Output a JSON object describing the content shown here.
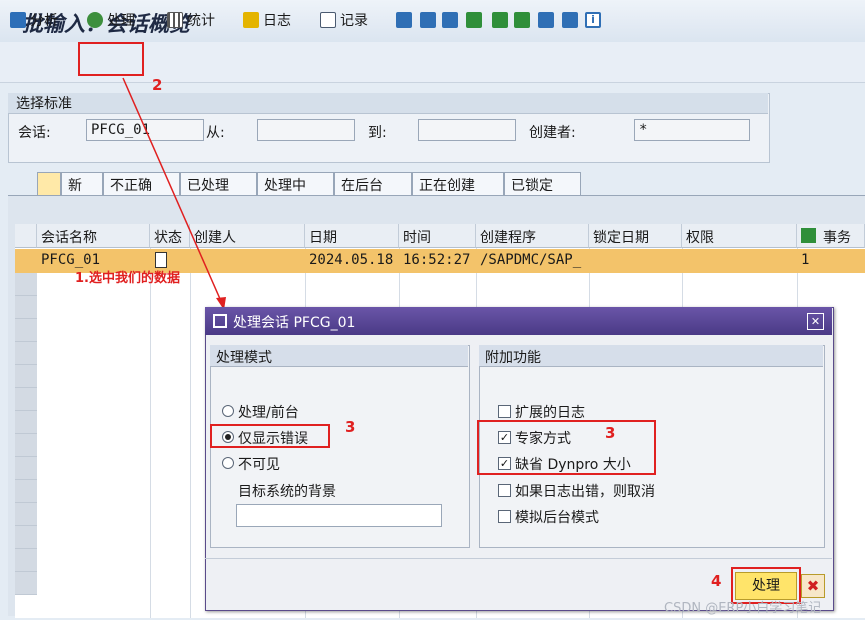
{
  "window": {
    "title": "批输入：会话概览"
  },
  "toolbar": {
    "analyze_label": "分析",
    "process_label": "处理",
    "stats_label": "统计",
    "log_label": "日志",
    "record_label": "记录",
    "info_icon_glyph": "i"
  },
  "selection": {
    "header": "选择标准",
    "session_label": "会话:",
    "session_value": "PFCG_01",
    "from_label": "从:",
    "from_value": "",
    "to_label": "到:",
    "to_value": "",
    "creator_label": "创建者:",
    "creator_value": "*"
  },
  "tabs": [
    "新",
    "不正确",
    "已处理",
    "处理中",
    "在后台",
    "正在创建",
    "已锁定"
  ],
  "table": {
    "columns": [
      "会话名称",
      "状态",
      "创建人",
      "日期",
      "时间",
      "创建程序",
      "锁定日期",
      "权限",
      "事务"
    ],
    "rows": [
      {
        "name": "PFCG_01",
        "status": "",
        "creator": "",
        "date": "2024.05.18",
        "time": "16:52:27",
        "program": "/SAPDMC/SAP_",
        "lock_date": "",
        "auth": "",
        "tx": "1"
      }
    ]
  },
  "dialog": {
    "title": "处理会话 PFCG_01",
    "mode_header": "处理模式",
    "modes": [
      "处理/前台",
      "仅显示错误",
      "不可见"
    ],
    "selected_mode": "仅显示错误",
    "target_bg_label": "目标系统的背景",
    "target_bg_value": "",
    "extra_header": "附加功能",
    "options": [
      {
        "label": "扩展的日志",
        "checked": false
      },
      {
        "label": "专家方式",
        "checked": true
      },
      {
        "label": "缺省 Dynpro 大小",
        "checked": true
      },
      {
        "label": "如果日志出错，则取消",
        "checked": false
      },
      {
        "label": "模拟后台模式",
        "checked": false
      }
    ],
    "process_button": "处理",
    "cancel_glyph": "✖",
    "close_glyph": "✕"
  },
  "annotations": {
    "select_note": "1.选中我们的数据",
    "step2": "2",
    "step3a": "3",
    "step3b": "3",
    "step4": "4"
  },
  "colors": {
    "accent_red": "#e02020",
    "dialog_title": "#5a48a0",
    "row_highlight": "#f3c36a"
  },
  "watermark": "CSDN @ERP小白学习笔记"
}
